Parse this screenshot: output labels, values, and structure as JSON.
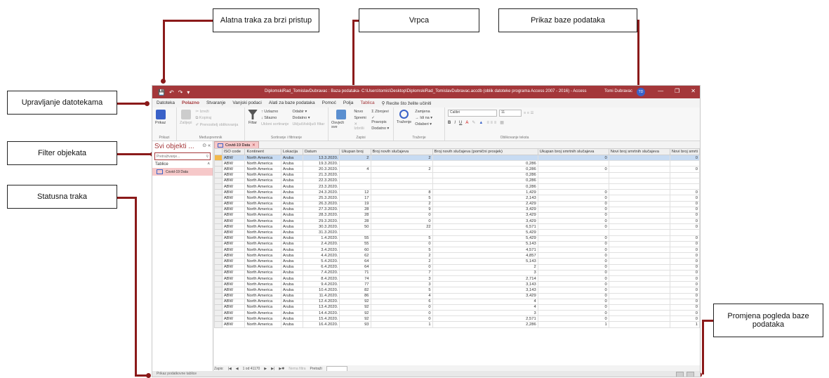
{
  "callouts": {
    "qat": "Alatna traka za brzi pristup",
    "ribbon": "Vrpca",
    "datasheet": "Prikaz baze podataka",
    "backstage": "Upravljanje datotekama",
    "filter": "Filter objekata",
    "status": "Statusna traka",
    "view_switch": "Promjena pogleda baze podataka"
  },
  "colors": {
    "accent": "#a4373a",
    "callout_line": "#8b1a1a",
    "selection": "#c7dbf2"
  },
  "window": {
    "title": "DiplomskiRad_TomislavDubravac : Baza podataka- C:\\Users\\tomis\\Desktop\\DiplomskiRad_TomislavDubravac.accdb (oblik datoteke programa Access 2007 - 2016) - Access",
    "user": "Tomi Dubravac",
    "user_initials": "TD"
  },
  "menu": {
    "items": [
      "Datoteka",
      "Polazno",
      "Stvaranje",
      "Vanjski podaci",
      "Alati za baze podataka",
      "Pomoć",
      "Polja",
      "Tablica"
    ],
    "search": "Recite što želite učiniti"
  },
  "ribbon": {
    "views": {
      "prikaz": "Prikaz",
      "group": "Prikazi"
    },
    "clipboard": {
      "zalijepi": "Zalijepi",
      "izrezi": "Izreži",
      "kopiraj": "Kopiraj",
      "oblik": "Prenositelj oblikovanja",
      "group": "Međuspremnik"
    },
    "sort": {
      "filtar": "Filtar",
      "uzlazno": "Uzlazno",
      "silazno": "Silazno",
      "ukloni": "Ukloni sortiranje",
      "odabir": "Odabir",
      "dodatno": "Dodatno",
      "ukljuci": "Uključi/isključi filtar",
      "group": "Sortiranje i filtriranje"
    },
    "records": {
      "osvjezi": "Osvježi sve",
      "novo": "Novo",
      "spremi": "Spremi",
      "izbrisi": "Izbriši",
      "zbrojevi": "Zbrojevi",
      "pravopis": "Pravopis",
      "dodatno": "Dodatno",
      "group": "Zapisi"
    },
    "find": {
      "trazenje": "Traženje",
      "zamjena": "Zamjena",
      "idi": "Idi na",
      "odaberi": "Odaberi",
      "group": "Traženje"
    },
    "text": {
      "font": "Calibri",
      "size": "11",
      "group": "Oblikovanje teksta"
    }
  },
  "nav": {
    "title": "Svi objekti ...",
    "search_placeholder": "Pretraživanje...",
    "section": "Tablice",
    "object": "Covid-19 Data"
  },
  "tab": {
    "label": "Covid-19 Data"
  },
  "table": {
    "columns": [
      "ISO code",
      "Kontinent",
      "Lokacija",
      "Datum",
      "Ukupan broj",
      "Broj novih slučajeva",
      "Broj novih slučajeva (pomični prosjek)",
      "Ukupan broj smrtnih slučajeva",
      "Novi broj smrtnih slučajeva",
      "Novi broj smrti"
    ],
    "rows": [
      [
        "ABW",
        "North America",
        "Aruba",
        "13.3.2020.",
        "2",
        "2",
        "",
        "0",
        "",
        "0"
      ],
      [
        "ABW",
        "North America",
        "Aruba",
        "19.3.2020.",
        "",
        "",
        "0,286",
        "",
        "",
        ""
      ],
      [
        "ABW",
        "North America",
        "Aruba",
        "20.3.2020.",
        "4",
        "2",
        "0,286",
        "0",
        "",
        "0"
      ],
      [
        "ABW",
        "North America",
        "Aruba",
        "21.3.2020.",
        "",
        "",
        "0,286",
        "",
        "",
        ""
      ],
      [
        "ABW",
        "North America",
        "Aruba",
        "22.3.2020.",
        "",
        "",
        "0,286",
        "",
        "",
        ""
      ],
      [
        "ABW",
        "North America",
        "Aruba",
        "23.3.2020.",
        "",
        "",
        "0,286",
        "",
        "",
        ""
      ],
      [
        "ABW",
        "North America",
        "Aruba",
        "24.3.2020.",
        "12",
        "8",
        "1,429",
        "0",
        "",
        "0"
      ],
      [
        "ABW",
        "North America",
        "Aruba",
        "25.3.2020.",
        "17",
        "5",
        "2,143",
        "0",
        "",
        "0"
      ],
      [
        "ABW",
        "North America",
        "Aruba",
        "26.3.2020.",
        "19",
        "2",
        "2,429",
        "0",
        "",
        "0"
      ],
      [
        "ABW",
        "North America",
        "Aruba",
        "27.3.2020.",
        "28",
        "9",
        "3,429",
        "0",
        "",
        "0"
      ],
      [
        "ABW",
        "North America",
        "Aruba",
        "28.3.2020.",
        "28",
        "0",
        "3,429",
        "0",
        "",
        "0"
      ],
      [
        "ABW",
        "North America",
        "Aruba",
        "29.3.2020.",
        "28",
        "0",
        "3,429",
        "0",
        "",
        "0"
      ],
      [
        "ABW",
        "North America",
        "Aruba",
        "30.3.2020.",
        "50",
        "22",
        "6,571",
        "0",
        "",
        "0"
      ],
      [
        "ABW",
        "North America",
        "Aruba",
        "31.3.2020.",
        "",
        "",
        "5,429",
        "",
        "",
        ""
      ],
      [
        "ABW",
        "North America",
        "Aruba",
        "1.4.2020.",
        "55",
        "5",
        "5,429",
        "0",
        "",
        "0"
      ],
      [
        "ABW",
        "North America",
        "Aruba",
        "2.4.2020.",
        "55",
        "0",
        "5,143",
        "0",
        "",
        "0"
      ],
      [
        "ABW",
        "North America",
        "Aruba",
        "3.4.2020.",
        "60",
        "5",
        "4,571",
        "0",
        "",
        "0"
      ],
      [
        "ABW",
        "North America",
        "Aruba",
        "4.4.2020.",
        "62",
        "2",
        "4,857",
        "0",
        "",
        "0"
      ],
      [
        "ABW",
        "North America",
        "Aruba",
        "5.4.2020.",
        "64",
        "2",
        "5,143",
        "0",
        "",
        "0"
      ],
      [
        "ABW",
        "North America",
        "Aruba",
        "6.4.2020.",
        "64",
        "0",
        "2",
        "0",
        "",
        "0"
      ],
      [
        "ABW",
        "North America",
        "Aruba",
        "7.4.2020.",
        "71",
        "7",
        "3",
        "0",
        "",
        "0"
      ],
      [
        "ABW",
        "North America",
        "Aruba",
        "8.4.2020.",
        "74",
        "3",
        "2,714",
        "0",
        "",
        "0"
      ],
      [
        "ABW",
        "North America",
        "Aruba",
        "9.4.2020.",
        "77",
        "3",
        "3,143",
        "0",
        "",
        "0"
      ],
      [
        "ABW",
        "North America",
        "Aruba",
        "10.4.2020.",
        "82",
        "5",
        "3,143",
        "0",
        "",
        "0"
      ],
      [
        "ABW",
        "North America",
        "Aruba",
        "11.4.2020.",
        "86",
        "4",
        "3,429",
        "0",
        "",
        "0"
      ],
      [
        "ABW",
        "North America",
        "Aruba",
        "12.4.2020.",
        "92",
        "6",
        "4",
        "0",
        "",
        "0"
      ],
      [
        "ABW",
        "North America",
        "Aruba",
        "13.4.2020.",
        "92",
        "0",
        "4",
        "0",
        "",
        "0"
      ],
      [
        "ABW",
        "North America",
        "Aruba",
        "14.4.2020.",
        "92",
        "0",
        "3",
        "0",
        "",
        "0"
      ],
      [
        "ABW",
        "North America",
        "Aruba",
        "15.4.2020.",
        "92",
        "0",
        "2,571",
        "0",
        "",
        "0"
      ],
      [
        "ABW",
        "North America",
        "Aruba",
        "16.4.2020.",
        "93",
        "1",
        "2,286",
        "1",
        "",
        "1"
      ]
    ]
  },
  "record_nav": {
    "label": "Zapis:",
    "position": "1 od 41170",
    "filter": "Nema filtra",
    "search": "Pretraži"
  },
  "status": {
    "text": "Prikaz podatkovne tablice"
  }
}
